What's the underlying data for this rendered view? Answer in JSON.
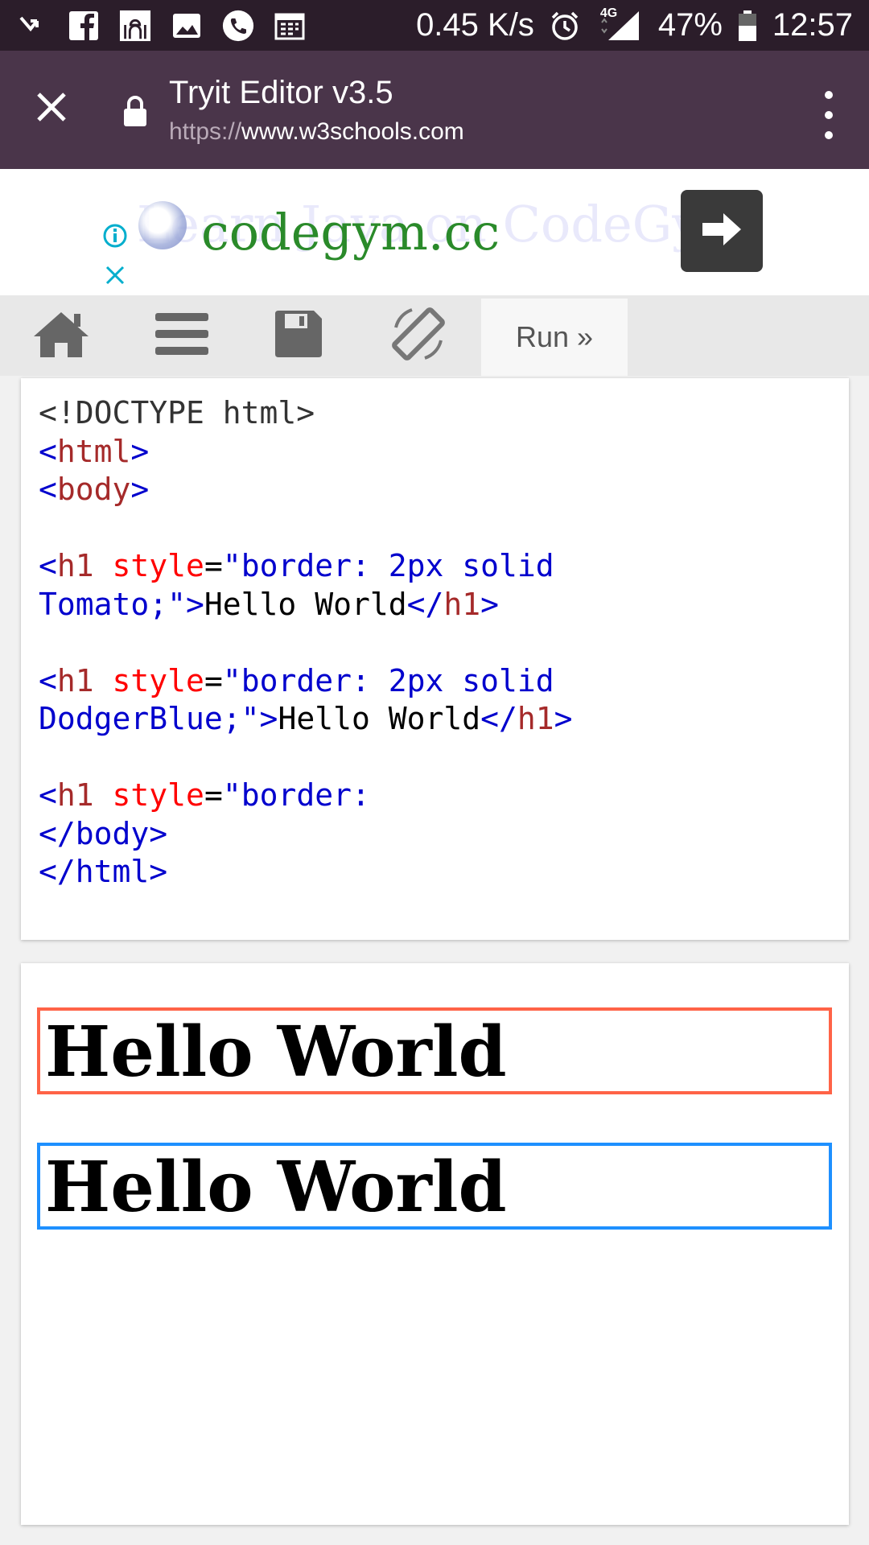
{
  "status_bar": {
    "net_speed": "0.45 K/s",
    "network": "4G",
    "battery": "47%",
    "time": "12:57",
    "icons": [
      "missed-call-icon",
      "facebook-icon",
      "mosque-app-icon",
      "gallery-icon",
      "phone-icon",
      "calendar-icon",
      "alarm-icon",
      "signal-icon",
      "battery-icon"
    ]
  },
  "toolbar": {
    "title": "Tryit Editor v3.5",
    "url_scheme": "https://",
    "url_host": "www.w3schools.com"
  },
  "ad": {
    "headline": "codegym.cc",
    "ghost_text": "Learn Java on CodeGym"
  },
  "nav": {
    "run_label": "Run »"
  },
  "code": [
    [
      {
        "t": "plain",
        "v": "<!DOCTYPE html>"
      }
    ],
    [
      {
        "t": "bracket",
        "v": "<"
      },
      {
        "t": "tag",
        "v": "html"
      },
      {
        "t": "bracket",
        "v": ">"
      }
    ],
    [
      {
        "t": "bracket",
        "v": "<"
      },
      {
        "t": "tag",
        "v": "body"
      },
      {
        "t": "bracket",
        "v": ">"
      }
    ],
    [],
    [
      {
        "t": "bracket",
        "v": "<"
      },
      {
        "t": "tag",
        "v": "h1"
      },
      {
        "t": "text",
        "v": " "
      },
      {
        "t": "attr",
        "v": "style"
      },
      {
        "t": "text",
        "v": "="
      },
      {
        "t": "val",
        "v": "\"border: 2px solid"
      }
    ],
    [
      {
        "t": "val",
        "v": "Tomato;\""
      },
      {
        "t": "bracket",
        "v": ">"
      },
      {
        "t": "text",
        "v": "Hello World"
      },
      {
        "t": "bracket",
        "v": "</"
      },
      {
        "t": "tag",
        "v": "h1"
      },
      {
        "t": "bracket",
        "v": ">"
      }
    ],
    [],
    [
      {
        "t": "bracket",
        "v": "<"
      },
      {
        "t": "tag",
        "v": "h1"
      },
      {
        "t": "text",
        "v": " "
      },
      {
        "t": "attr",
        "v": "style"
      },
      {
        "t": "text",
        "v": "="
      },
      {
        "t": "val",
        "v": "\"border: 2px solid"
      }
    ],
    [
      {
        "t": "val",
        "v": "DodgerBlue;\""
      },
      {
        "t": "bracket",
        "v": ">"
      },
      {
        "t": "text",
        "v": "Hello World"
      },
      {
        "t": "bracket",
        "v": "</"
      },
      {
        "t": "tag",
        "v": "h1"
      },
      {
        "t": "bracket",
        "v": ">"
      }
    ],
    [],
    [
      {
        "t": "bracket",
        "v": "<"
      },
      {
        "t": "tag",
        "v": "h1"
      },
      {
        "t": "text",
        "v": " "
      },
      {
        "t": "attr",
        "v": "style"
      },
      {
        "t": "text",
        "v": "="
      },
      {
        "t": "val",
        "v": "\"border:"
      }
    ],
    [
      {
        "t": "bracket",
        "v": "</"
      },
      {
        "t": "bracket",
        "v": "body"
      },
      {
        "t": "bracket",
        "v": ">"
      }
    ],
    [
      {
        "t": "bracket",
        "v": "</"
      },
      {
        "t": "bracket",
        "v": "html"
      },
      {
        "t": "bracket",
        "v": ">"
      }
    ]
  ],
  "result": {
    "heading_1": "Hello World",
    "heading_2": "Hello World",
    "border_1_color": "#ff6347",
    "border_2_color": "#1e90ff"
  }
}
